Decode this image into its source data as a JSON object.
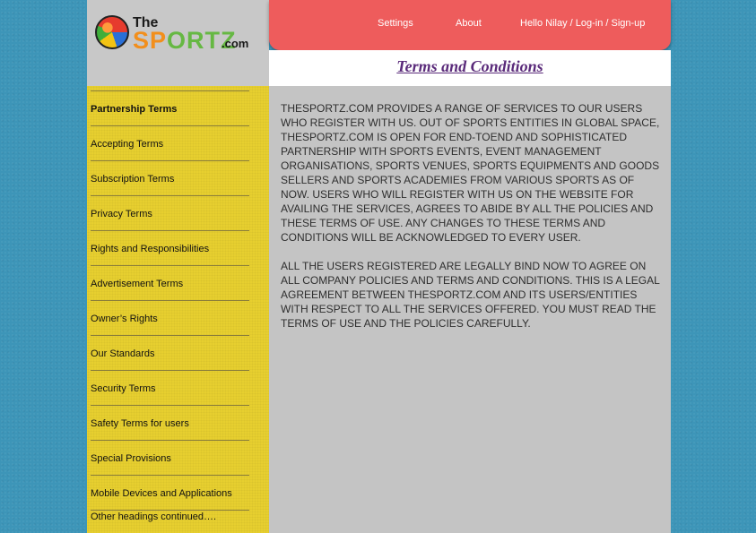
{
  "logo": {
    "the": "The",
    "sportz_a": "SP",
    "sportz_b": "ORTZ",
    "com": ".com"
  },
  "nav": {
    "settings": "Settings",
    "about": "About",
    "user": "Hello Nilay / Log-in / Sign-up"
  },
  "page_title": "Terms and Conditions",
  "sidebar": {
    "items": [
      "Partnership Terms",
      "Accepting Terms",
      "Subscription Terms",
      "Privacy Terms",
      "Rights and Responsibilities",
      "Advertisement Terms",
      "Owner’s Rights",
      "Our Standards",
      "Security Terms",
      "Safety Terms for users",
      "Special Provisions",
      "Mobile Devices and Applications"
    ],
    "more": "Other headings continued…."
  },
  "content": {
    "paragraph1": "THESPORTZ.COM PROVIDES A RANGE OF SERVICES TO OUR USERS WHO REGISTER WITH US. OUT OF SPORTS ENTITIES IN GLOBAL SPACE, THESPORTZ.COM IS OPEN FOR END-TOEND AND SOPHISTICATED PARTNERSHIP WITH SPORTS EVENTS, EVENT MANAGEMENT ORGANISATIONS, SPORTS VENUES, SPORTS EQUIPMENTS AND GOODS SELLERS AND SPORTS ACADEMIES FROM VARIOUS SPORTS AS OF NOW. USERS WHO WILL REGISTER WITH US ON THE WEBSITE FOR AVAILING THE SERVICES, AGREES TO ABIDE BY ALL THE POLICIES AND THESE TERMS OF USE. ANY CHANGES TO THESE TERMS AND CONDITIONS WILL BE ACKNOWLEDGED TO EVERY USER.",
    "paragraph2": "ALL THE USERS REGISTERED ARE LEGALLY BIND NOW TO AGREE ON ALL COMPANY POLICIES AND TERMS AND CONDITIONS. THIS IS A LEGAL AGREEMENT BETWEEN THESPORTZ.COM AND ITS USERS/ENTITIES WITH RESPECT TO ALL THE SERVICES OFFERED. YOU MUST READ THE TERMS OF USE AND THE POLICIES CAREFULLY."
  },
  "colors": {
    "page_bg": "#3d95b8",
    "nav_bg": "#ee5c5c",
    "sidebar_bg": "#e7cf2f",
    "content_bg": "#c4c4c4",
    "title_color": "#5a2a7a"
  }
}
